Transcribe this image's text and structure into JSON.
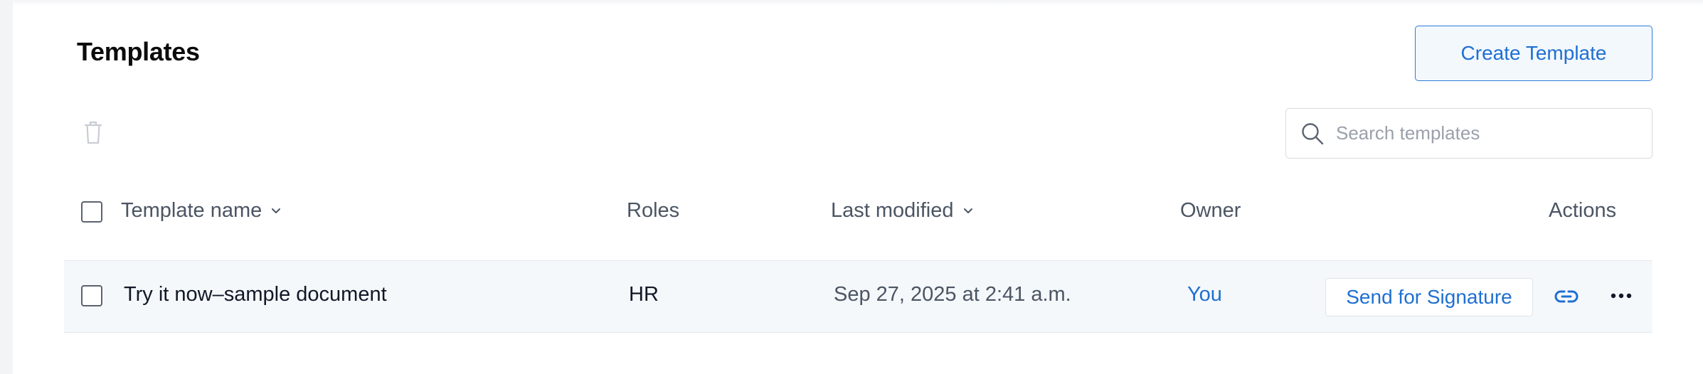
{
  "page": {
    "title": "Templates",
    "create_button_label": "Create Template"
  },
  "search": {
    "placeholder": "Search templates",
    "value": ""
  },
  "table": {
    "columns": {
      "name": "Template name",
      "roles": "Roles",
      "last_modified": "Last modified",
      "owner": "Owner",
      "actions": "Actions"
    },
    "rows": [
      {
        "name": "Try it now–sample document",
        "roles": "HR",
        "last_modified": "Sep 27, 2025 at 2:41 a.m.",
        "owner": "You",
        "send_label": "Send for Signature"
      }
    ]
  },
  "icons": {
    "delete": "trash-icon",
    "search": "search-icon",
    "sort": "chevron-down-icon",
    "link": "link-icon",
    "more": "more-horizontal-icon"
  },
  "colors": {
    "accent": "#1f6fd1",
    "row_background": "#f5f8fb",
    "button_background": "#f3f8fd",
    "muted_text": "#4b5563"
  }
}
